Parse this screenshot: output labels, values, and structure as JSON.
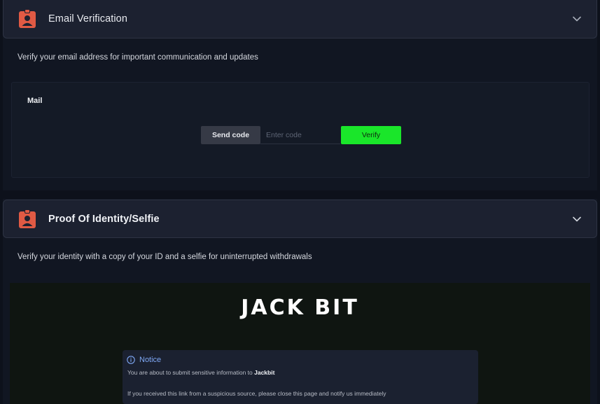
{
  "email_section": {
    "title": "Email Verification",
    "description": "Verify your email address for important communication and updates",
    "card": {
      "label": "Mail",
      "send_code_label": "Send code",
      "code_placeholder": "Enter code",
      "verify_label": "Verify"
    }
  },
  "identity_section": {
    "title": "Proof Of Identity/Selfie",
    "description": "Verify your identity with a copy of your ID and a selfie for uninterrupted withdrawals",
    "logo_text": "JACK BIT",
    "notice": {
      "title": "Notice",
      "line1_prefix": "You are about to submit sensitive information to ",
      "line1_brand": "Jackbit",
      "line2": "If you received this link from a suspicious source, please close this page and notify us immediately"
    }
  },
  "colors": {
    "accent_green": "#1ae62a",
    "badge_red": "#e05a44",
    "notice_blue": "#7fa8f5"
  }
}
